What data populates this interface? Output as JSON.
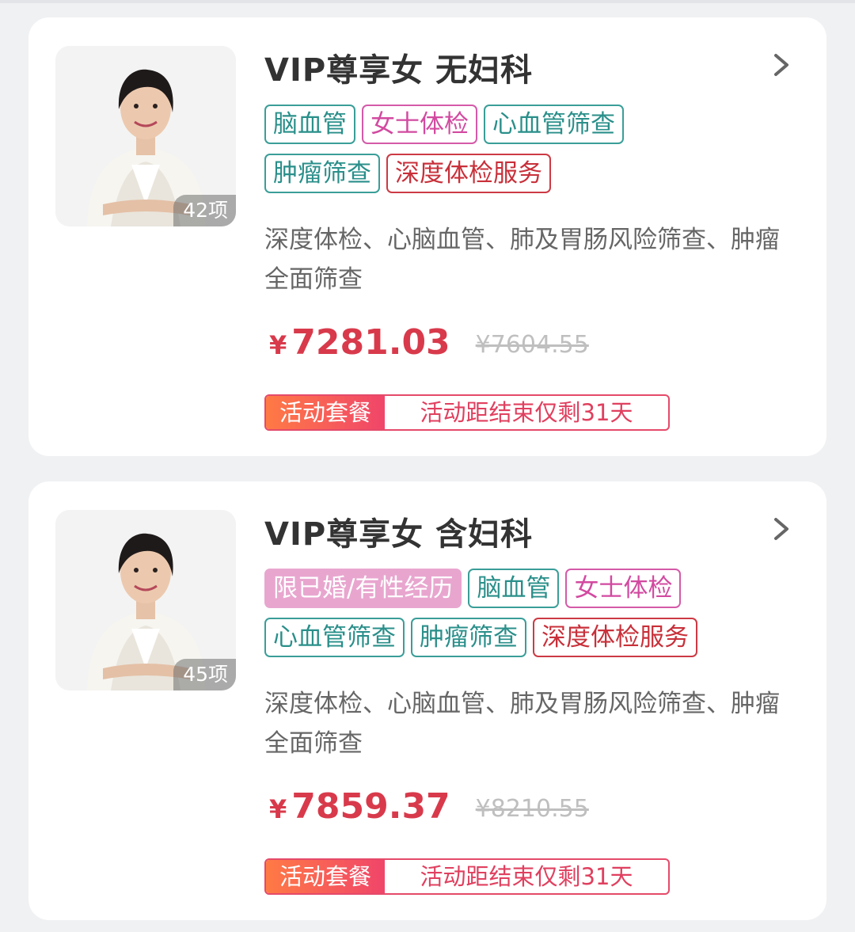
{
  "cards": [
    {
      "title": "VIP尊享女 无妇科",
      "item_count": "42项",
      "tags": [
        "脑血管",
        "女士体检",
        "心血管筛查",
        "肿瘤筛查",
        "深度体检服务"
      ],
      "description": "深度体检、心脑血管、肺及胃肠风险筛查、肿瘤全面筛查",
      "currency": "¥",
      "price": "7281.03",
      "original_price": "¥7604.55",
      "promo_label": "活动套餐",
      "promo_text": "活动距结束仅剩31天"
    },
    {
      "title": "VIP尊享女 含妇科",
      "item_count": "45项",
      "tags": [
        "限已婚/有性经历",
        "脑血管",
        "女士体检",
        "心血管筛查",
        "肿瘤筛查",
        "深度体检服务"
      ],
      "description": "深度体检、心脑血管、肺及胃肠风险筛查、肿瘤全面筛查",
      "currency": "¥",
      "price": "7859.37",
      "original_price": "¥8210.55",
      "promo_label": "活动套餐",
      "promo_text": "活动距结束仅剩31天"
    }
  ],
  "colors": {
    "price": "#d83a4b",
    "tag_teal": "#2a8f8a",
    "tag_pink": "#d24aa0",
    "tag_red": "#c8303a",
    "tag_restricted_fill": "#e8a6cf",
    "promo_gradient_start": "#ff7a45",
    "promo_gradient_end": "#f0456a"
  },
  "icons": {
    "thumbnail": "woman-portrait-image",
    "arrow": "chevron-right-icon"
  }
}
